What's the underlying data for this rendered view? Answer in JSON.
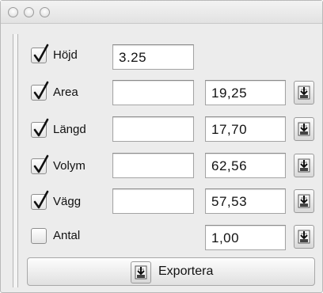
{
  "rows": [
    {
      "label": "Höjd",
      "checked": true,
      "input_value": "3.25",
      "result_value": ""
    },
    {
      "label": "Area",
      "checked": true,
      "input_value": "",
      "result_value": "19,25"
    },
    {
      "label": "Längd",
      "checked": true,
      "input_value": "",
      "result_value": "17,70"
    },
    {
      "label": "Volym",
      "checked": true,
      "input_value": "",
      "result_value": "62,56"
    },
    {
      "label": "Vägg",
      "checked": true,
      "input_value": "",
      "result_value": "57,53"
    },
    {
      "label": "Antal",
      "checked": false,
      "input_value": "",
      "result_value": "1,00"
    }
  ],
  "export_button": {
    "label": "Exportera"
  },
  "icons": {
    "window_controls": [
      "close-icon",
      "minimize-icon",
      "zoom-icon"
    ],
    "row_action": "export-arrow-icon",
    "checkbox_mark": "checkmark-icon"
  }
}
